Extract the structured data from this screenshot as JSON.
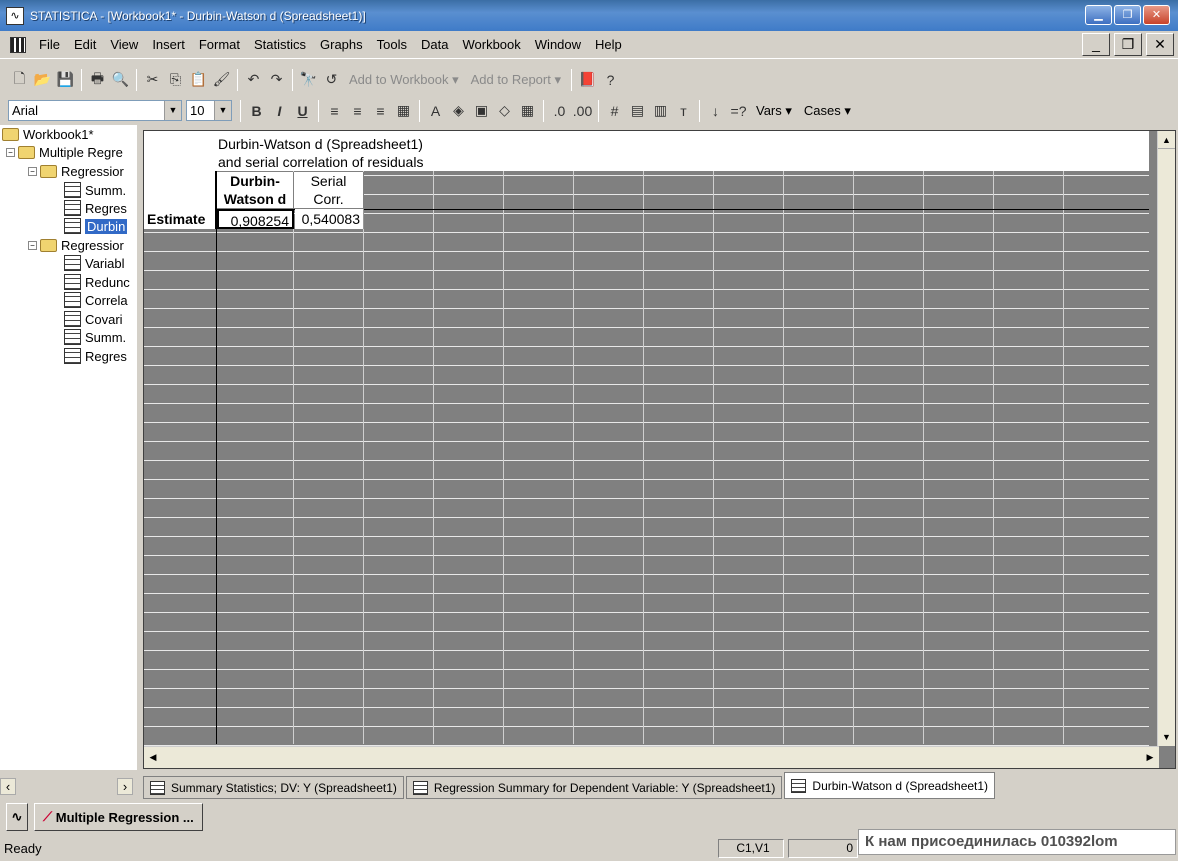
{
  "window": {
    "title": "STATISTICA - [Workbook1* - Durbin-Watson d (Spreadsheet1)]",
    "min_label": "▁",
    "max_label": "❐",
    "close_label": "✕"
  },
  "menu": {
    "items": [
      "File",
      "Edit",
      "View",
      "Insert",
      "Format",
      "Statistics",
      "Graphs",
      "Tools",
      "Data",
      "Workbook",
      "Window",
      "Help"
    ]
  },
  "toolbar1": {
    "add_workbook": "Add to Workbook ▾",
    "add_report": "Add to Report ▾"
  },
  "toolbar2": {
    "font": "Arial",
    "size": "10",
    "vars": "Vars ▾",
    "cases": "Cases ▾",
    "bold": "B",
    "italic": "I",
    "underline": "U"
  },
  "tree": {
    "workbook": "Workbook1*",
    "multiple": "Multiple Regre",
    "regression1": "Regressior",
    "r1_items": [
      "Summ.",
      "Regres",
      "Durbin"
    ],
    "regression2": "Regressior",
    "r2_items": [
      "Variabl",
      "Redunc",
      "Correla",
      "Covari",
      "Summ.",
      "Regres"
    ]
  },
  "spreadsheet": {
    "header_line1": "Durbin-Watson d (Spreadsheet1)",
    "header_line2": "and serial correlation of residuals",
    "col1_l1": "Durbin-",
    "col1_l2": "Watson d",
    "col2_l1": "Serial",
    "col2_l2": "Corr.",
    "row_label": "Estimate",
    "v1": "0,908254",
    "v2": "0,540083"
  },
  "tabs": [
    "Summary Statistics; DV: Y (Spreadsheet1)",
    "Regression Summary for Dependent Variable: Y (Spreadsheet1)",
    "Durbin-Watson d (Spreadsheet1)"
  ],
  "taskbar": {
    "button": "Multiple Regression ..."
  },
  "status": {
    "text": "Ready",
    "cell": "C1,V1",
    "extra": "0"
  },
  "toast": "К нам присоединилась 010392lom"
}
